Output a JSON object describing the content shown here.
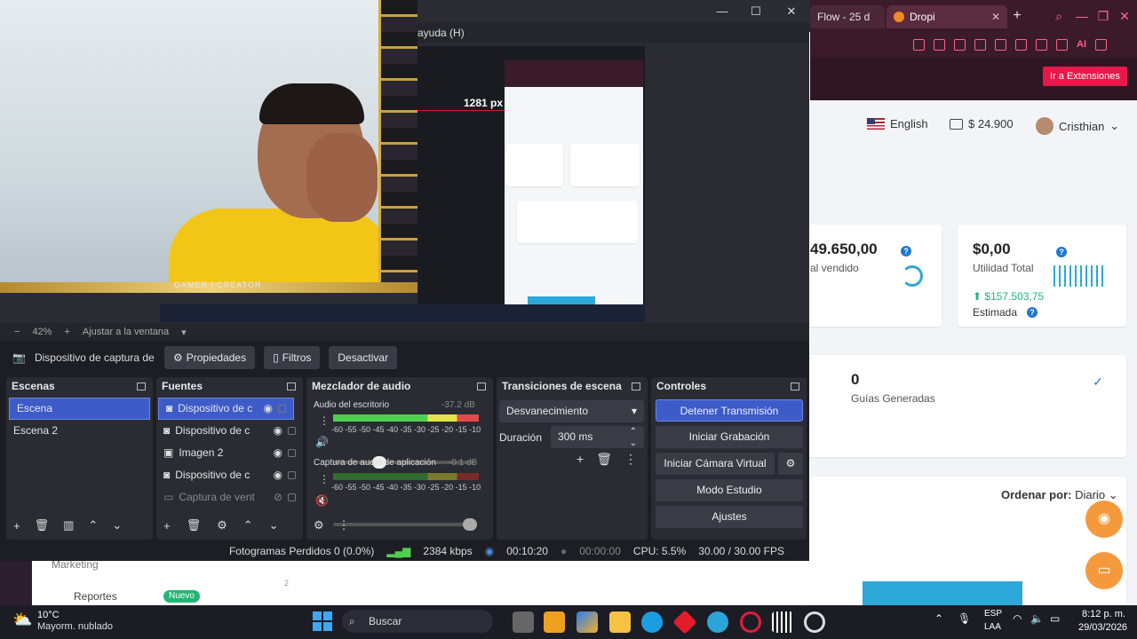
{
  "browser": {
    "tabs": [
      {
        "label": "Flow - 25 d"
      },
      {
        "label": "Dropi"
      }
    ],
    "new_tab": "+",
    "ext_ai": "AI",
    "extensions_button": "Ir a Extensiones",
    "language": "English",
    "balance": "$ 24.900",
    "user": "Cristhian",
    "cards": {
      "sales_value": "49.650,00",
      "sales_label": "al vendido",
      "profit_value": "$0,00",
      "profit_label": "Utilidad Total",
      "profit_estimated_value": "$157.503,75",
      "profit_estimated_label": "Estimada",
      "guides_value": "0",
      "guides_label": "Guías Generadas",
      "order_label": "Ordenar por:",
      "order_value": "Diario"
    },
    "sidebar": {
      "marketing": "Marketing",
      "reportes": "Reportes",
      "nuevo_badge": "Nuevo"
    },
    "chart_tick": "2"
  },
  "obs": {
    "menu_help": "ayuda (H)",
    "preview_px_label": "1281 px",
    "zoom_percent": "42%",
    "fit_label": "Ajustar a la ventana",
    "source_selected": "Dispositivo de captura de v",
    "properties_button": "Propiedades",
    "filters_button": "Filtros",
    "deactivate_button": "Desactivar",
    "scenes_title": "Escenas",
    "scenes": [
      "Escena",
      "Escena 2"
    ],
    "sources_title": "Fuentes",
    "sources": [
      {
        "label": "Dispositivo de c"
      },
      {
        "label": "Dispositivo de c"
      },
      {
        "label": "Imagen 2"
      },
      {
        "label": "Dispositivo de c"
      },
      {
        "label": "Captura de vent"
      }
    ],
    "mixer_title": "Mezclador de audio",
    "mixer": [
      {
        "name": "Audio del escritorio",
        "db": "-37.2 dB",
        "level": 0.4
      },
      {
        "name": "Captura de audio de aplicación (BE",
        "db": "-0.1 dB",
        "level": 0.0
      }
    ],
    "meter_scale": "-60 -55 -50 -45 -40 -35 -30 -25 -20 -15 -10 -5 0",
    "transitions_title": "Transiciones de escena",
    "transition_value": "Desvanecimiento",
    "duration_label": "Duración",
    "duration_value": "300 ms",
    "controls_title": "Controles",
    "controls": {
      "stop_stream": "Detener Transmisión",
      "start_recording": "Iniciar Grabación",
      "start_vcam": "Iniciar Cámara Virtual",
      "studio_mode": "Modo Estudio",
      "settings": "Ajustes"
    },
    "status": {
      "dropped_frames": "Fotogramas Perdidos 0 (0.0%)",
      "bitrate": "2384 kbps",
      "stream_time": "00:10:20",
      "rec_time": "00:00:00",
      "cpu": "CPU: 5.5%",
      "fps": "30.00 / 30.00 FPS"
    },
    "webcam_overlay": "GAMER | CREATOR"
  },
  "taskbar": {
    "weather_temp": "10°C",
    "weather_desc": "Mayorm. nublado",
    "search": "Buscar",
    "lang_top": "ESP",
    "lang_bottom": "LAA",
    "time": "8:12 p. m.",
    "date": "29/03/2026"
  },
  "colors": {
    "obs_bg": "#1d1e24",
    "obs_dock": "#2b2c33",
    "obs_accent": "#3d5bc9",
    "dropi_dark": "#3b1b2a",
    "dropi_red": "#e8194a",
    "fab_orange": "#f59a3c"
  }
}
